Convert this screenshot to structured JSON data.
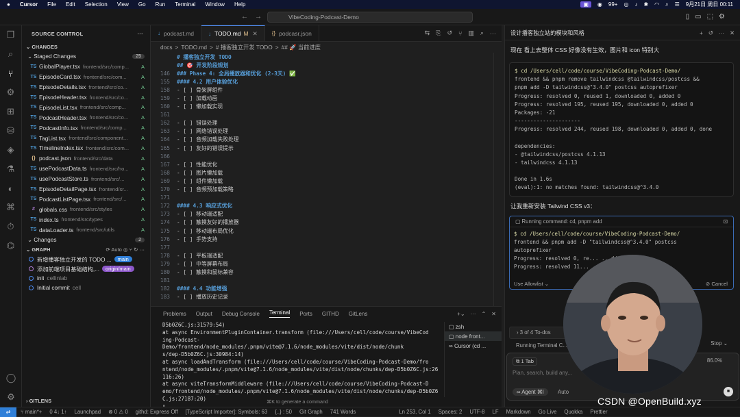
{
  "menubar": {
    "app": "Cursor",
    "items": [
      "File",
      "Edit",
      "Selection",
      "View",
      "Go",
      "Run",
      "Terminal",
      "Window",
      "Help"
    ],
    "badge": "99+",
    "datetime": "9月21日 周日 00:11"
  },
  "titlebar": {
    "search": "VibeCoding-Podcast-Demo"
  },
  "sidebar": {
    "title": "SOURCE CONTROL",
    "changes_label": "CHANGES",
    "staged_label": "Staged Changes",
    "staged_count": "25",
    "files": [
      {
        "type": "TS",
        "name": "GlobalPlayer.tsx",
        "path": "frontend/src/comp...",
        "status": "A",
        "color": "#4f9dda"
      },
      {
        "type": "TS",
        "name": "EpisodeCard.tsx",
        "path": "frontend/src/com...",
        "status": "A",
        "color": "#4f9dda"
      },
      {
        "type": "TS",
        "name": "EpisodeDetails.tsx",
        "path": "frontend/src/co...",
        "status": "A",
        "color": "#4f9dda"
      },
      {
        "type": "TS",
        "name": "EpisodeHeader.tsx",
        "path": "frontend/src/co...",
        "status": "A",
        "color": "#4f9dda"
      },
      {
        "type": "TS",
        "name": "EpisodeList.tsx",
        "path": "frontend/src/comp...",
        "status": "A",
        "color": "#4f9dda"
      },
      {
        "type": "TS",
        "name": "PodcastHeader.tsx",
        "path": "frontend/src/co...",
        "status": "A",
        "color": "#4f9dda"
      },
      {
        "type": "TS",
        "name": "PodcastInfo.tsx",
        "path": "frontend/src/comp...",
        "status": "A",
        "color": "#4f9dda"
      },
      {
        "type": "TS",
        "name": "TagList.tsx",
        "path": "frontend/src/component...",
        "status": "A",
        "color": "#4f9dda"
      },
      {
        "type": "TS",
        "name": "TimelineIndex.tsx",
        "path": "frontend/src/com...",
        "status": "A",
        "color": "#4f9dda"
      },
      {
        "type": "{}",
        "name": "podcast.json",
        "path": "frontend/src/data",
        "status": "A",
        "color": "#e2c08d"
      },
      {
        "type": "TS",
        "name": "usePodcastData.ts",
        "path": "frontend/src/ho...",
        "status": "A",
        "color": "#4f9dda"
      },
      {
        "type": "TS",
        "name": "usePodcastStore.ts",
        "path": "frontend/src/...",
        "status": "A",
        "color": "#4f9dda"
      },
      {
        "type": "TS",
        "name": "EpisodeDetailPage.tsx",
        "path": "frontend/sr...",
        "status": "A",
        "color": "#4f9dda"
      },
      {
        "type": "TS",
        "name": "PodcastListPage.tsx",
        "path": "frontend/src/...",
        "status": "A",
        "color": "#4f9dda"
      },
      {
        "type": "#",
        "name": "globals.css",
        "path": "frontend/src/styles",
        "status": "A",
        "color": "#b180d7"
      },
      {
        "type": "TS",
        "name": "index.ts",
        "path": "frontend/src/types",
        "status": "A",
        "color": "#4f9dda"
      },
      {
        "type": "TS",
        "name": "dataLoader.ts",
        "path": "frontend/src/utils",
        "status": "A",
        "color": "#4f9dda"
      }
    ],
    "changes2_label": "Changes",
    "changes2_count": "2",
    "graph_label": "GRAPH",
    "graph_auto": "Auto",
    "commits": [
      {
        "msg": "新增播客独立开发的 TODO ...",
        "author": "",
        "pill": "main"
      },
      {
        "msg": "添加前端项目基础结构,...",
        "author": "",
        "pill": "origin/main"
      },
      {
        "msg": "init",
        "author": "cellinlab",
        "pill": ""
      },
      {
        "msg": "Initial commit",
        "author": "cell",
        "pill": ""
      }
    ],
    "gitlens_label": "GITLENS"
  },
  "editor": {
    "tabs": [
      {
        "label": "podcast.md",
        "icon": "↓"
      },
      {
        "label": "TODO.md",
        "icon": "↓",
        "modified": "M",
        "active": true
      },
      {
        "label": "podcasr.json",
        "icon": "{}"
      }
    ],
    "breadcrumb": [
      "docs",
      ">",
      "TODO.md",
      ">",
      "# 播客独立开发 TODO",
      ">",
      "## 🚀 当前进度"
    ],
    "sticky": [
      {
        "n": "",
        "t": "# 播客独立开发 TODO"
      },
      {
        "n": "",
        "t": "## 🎯 开发阶段规划"
      },
      {
        "n": "146",
        "t": "### Phase 4: 全局播放器和优化 (2-3天) ✅"
      },
      {
        "n": "155",
        "t": "#### 4.2 用户体验优化"
      }
    ],
    "lines": [
      {
        "n": "158",
        "t": "  - [ ] 骨架屏组件"
      },
      {
        "n": "159",
        "t": "  - [ ] 加载动画"
      },
      {
        "n": "160",
        "t": "  - [ ] 懒加载实现"
      },
      {
        "n": "161",
        "t": ""
      },
      {
        "n": "162",
        "t": "- [ ] 错误处理"
      },
      {
        "n": "163",
        "t": "  - [ ] 网络错误处理"
      },
      {
        "n": "164",
        "t": "  - [ ] 音频加载失败处理"
      },
      {
        "n": "165",
        "t": "  - [ ] 友好的错误提示"
      },
      {
        "n": "166",
        "t": ""
      },
      {
        "n": "167",
        "t": "- [ ] 性能优化"
      },
      {
        "n": "168",
        "t": "  - [ ] 图片懒加载"
      },
      {
        "n": "169",
        "t": "  - [ ] 组件懒加载"
      },
      {
        "n": "170",
        "t": "  - [ ] 音频预加载策略"
      },
      {
        "n": "171",
        "t": ""
      },
      {
        "n": "172",
        "t": "#### 4.3 响应式优化",
        "h": true
      },
      {
        "n": "173",
        "t": "- [ ] 移动端适配"
      },
      {
        "n": "174",
        "t": "  - [ ] 触摸友好的播放器"
      },
      {
        "n": "175",
        "t": "  - [ ] 移动端布局优化"
      },
      {
        "n": "176",
        "t": "  - [ ] 手势支持"
      },
      {
        "n": "177",
        "t": ""
      },
      {
        "n": "178",
        "t": "- [ ] 平板端适配"
      },
      {
        "n": "179",
        "t": "  - [ ] 中等屏幕布局"
      },
      {
        "n": "180",
        "t": "  - [ ] 触摸和鼠标兼容"
      },
      {
        "n": "181",
        "t": ""
      },
      {
        "n": "182",
        "t": "#### 4.4 功能增强",
        "h": true
      },
      {
        "n": "183",
        "t": "- [ ] 播放历史记录"
      }
    ]
  },
  "panel": {
    "tabs": [
      "Problems",
      "Output",
      "Debug Console",
      "Terminal",
      "Ports",
      "GITHD",
      "GitLens"
    ],
    "active_tab": "Terminal",
    "terminal_lines": [
      "D5b0Z6C.js:31579:54)",
      "    at async EnvironmentPluginContainer.transform (file:///Users/cell/code/course/VibeCod",
      "ing-Podcast-Demo/frontend/node_modules/.pnpm/vite@7.1.6/node_modules/vite/dist/node/chunk",
      "s/dep-D5b0Z6C.js:30984:14)",
      "    at async loadAndTransform (file:///Users/cell/code/course/VibeCoding-Podcast-Demo/fro",
      "ntend/node_modules/.pnpm/vite@7.1.6/node_modules/vite/dist/node/chunks/dep-D5b0Z6C.js:26",
      "116:26)",
      "    at async viteTransformMiddleware (file:///Users/cell/code/course/VibeCoding-Podcast-D",
      "emo/frontend/node_modules/.pnpm/vite@7.1.6/node_modules/vite/dist/node/chunks/dep-D5b0Z6",
      "C.js:27187:20)",
      "▯"
    ],
    "terminals": [
      "zsh",
      "node  front...",
      "Cursor (cd ..."
    ],
    "hint": "⌘K to generate a command"
  },
  "chat": {
    "title": "设计播客独立站的模块和风格",
    "question": "现在 看上去整体 CSS 好像没有生效，图片和 icon 特别大",
    "block1": [
      "$ cd /Users/cell/code/course/VibeCoding-Podcast-Demo/",
      "frontend && pnpm remove tailwindcss @tailwindcss/postcss &&",
      "pnpm add -D tailwindcss@\"3.4.0\" postcss autoprefixer",
      "Progress: resolved 0, reused 1, downloaded 0, added 0",
      "Progress: resolved 195, reused 195, downloaded 0, added 0",
      "Packages: -21",
      "---------------------",
      "Progress: resolved 244, reused 198, downloaded 0, added 0, done",
      "",
      "dependencies:",
      "- @tailwindcss/postcss 4.1.13",
      "- tailwindcss 4.1.13",
      "",
      "Done in 1.6s",
      "(eval):1: no matches found: tailwindcss@^3.4.0"
    ],
    "message2": "让我重新安装 Tailwind CSS v3：",
    "run_header": "Running command: cd, pnpm add",
    "block2": [
      "$ cd /Users/cell/code/course/VibeCoding-Podcast-Demo/",
      "frontend && pnpm add -D \"tailwindcss@^3.4.0\" postcss",
      "autoprefixer",
      "Progress: resolved 0, re... ...dded 0",
      "Progress: resolved 11..."
    ],
    "allowlist": "Use Allowlist",
    "cancel": "Cancel",
    "todos": "3 of 4 To-dos",
    "running_terminal": "Running Terminal C...",
    "stop": "Stop",
    "tab_ctx": "1 Tab",
    "percent": "86.0%",
    "placeholder": "Plan, search, build any...",
    "agent": "Agent",
    "auto": "Auto"
  },
  "watermark": "CSDN @OpenBuild.xyz",
  "statusbar": [
    "main*+",
    "0 4↓ 1↑",
    "Launchpad",
    "⊗ 0 ⚠ 0",
    "githd: Express Off",
    "[TypeScript Importer]: Symbols: 63",
    "{..} : 50",
    "Git Graph",
    "741 Words",
    "Ln 253, Col 1",
    "Spaces: 2",
    "UTF-8",
    "LF",
    "Markdown",
    "Go Live",
    "Quokka",
    "Prettier"
  ]
}
